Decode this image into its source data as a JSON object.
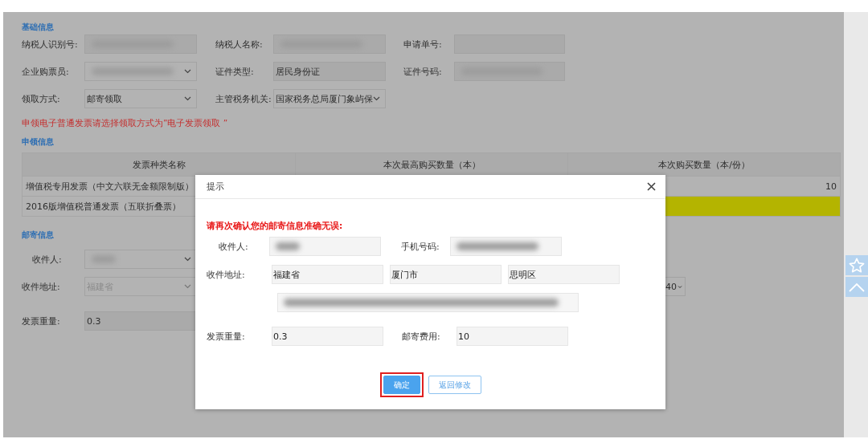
{
  "basic": {
    "title": "基础信息",
    "rows": [
      {
        "fields": [
          {
            "label": "纳税人识别号:",
            "kind": "text",
            "redacted": true
          },
          {
            "label": "纳税人名称:",
            "kind": "text",
            "redacted": true
          },
          {
            "label": "申请单号:",
            "kind": "text",
            "redacted": false
          }
        ]
      },
      {
        "fields": [
          {
            "label": "企业购票员:",
            "kind": "select",
            "redacted": true
          },
          {
            "label": "证件类型:",
            "kind": "text",
            "value": "居民身份证",
            "redacted": false
          },
          {
            "label": "证件号码:",
            "kind": "text",
            "redacted": true
          }
        ]
      },
      {
        "fields": [
          {
            "label": "领取方式:",
            "kind": "select",
            "value": "邮寄领取",
            "redacted": false
          },
          {
            "label": "主管税务机关:",
            "kind": "select",
            "value": "国家税务总局厦门象屿保",
            "redacted": false
          }
        ]
      }
    ],
    "note": "申领电子普通发票请选择领取方式为”电子发票领取 ”"
  },
  "apply": {
    "title": "申领信息",
    "columns": [
      "发票种类名称",
      "本次最高购买数量（本）",
      "本次购买数量（本/份）"
    ],
    "rows": [
      {
        "name": "增值税专用发票（中文六联无金额限制版）",
        "quantity": "10",
        "highlighted": false
      },
      {
        "name": "2016版增值税普通发票（五联折叠票）",
        "highlighted": true
      }
    ]
  },
  "mailing": {
    "title": "邮寄信息",
    "recipient": {
      "label": "收件人:",
      "redacted": true
    },
    "address": {
      "label": "收件地址:",
      "province": "福建省",
      "disabled": true,
      "extra_select": "40"
    },
    "weight": {
      "label": "发票重量:",
      "value": "0.3"
    }
  },
  "dialog": {
    "title": "提示",
    "warning": "请再次确认您的邮寄信息准确无误:",
    "recipient": {
      "label": "收件人:",
      "redacted": true
    },
    "phone": {
      "label": "手机号码:",
      "redacted": true
    },
    "address": {
      "label": "收件地址:",
      "parts": [
        "福建省",
        "厦门市",
        "思明区"
      ],
      "detail_redacted": true
    },
    "weight": {
      "label": "发票重量:",
      "value": "0.3"
    },
    "fee": {
      "label": "邮寄费用:",
      "value": "10"
    },
    "buttons": [
      {
        "label": "确定",
        "kind": "primary",
        "highlighted": true
      },
      {
        "label": "返回修改",
        "kind": "secondary",
        "highlighted": false
      }
    ]
  }
}
